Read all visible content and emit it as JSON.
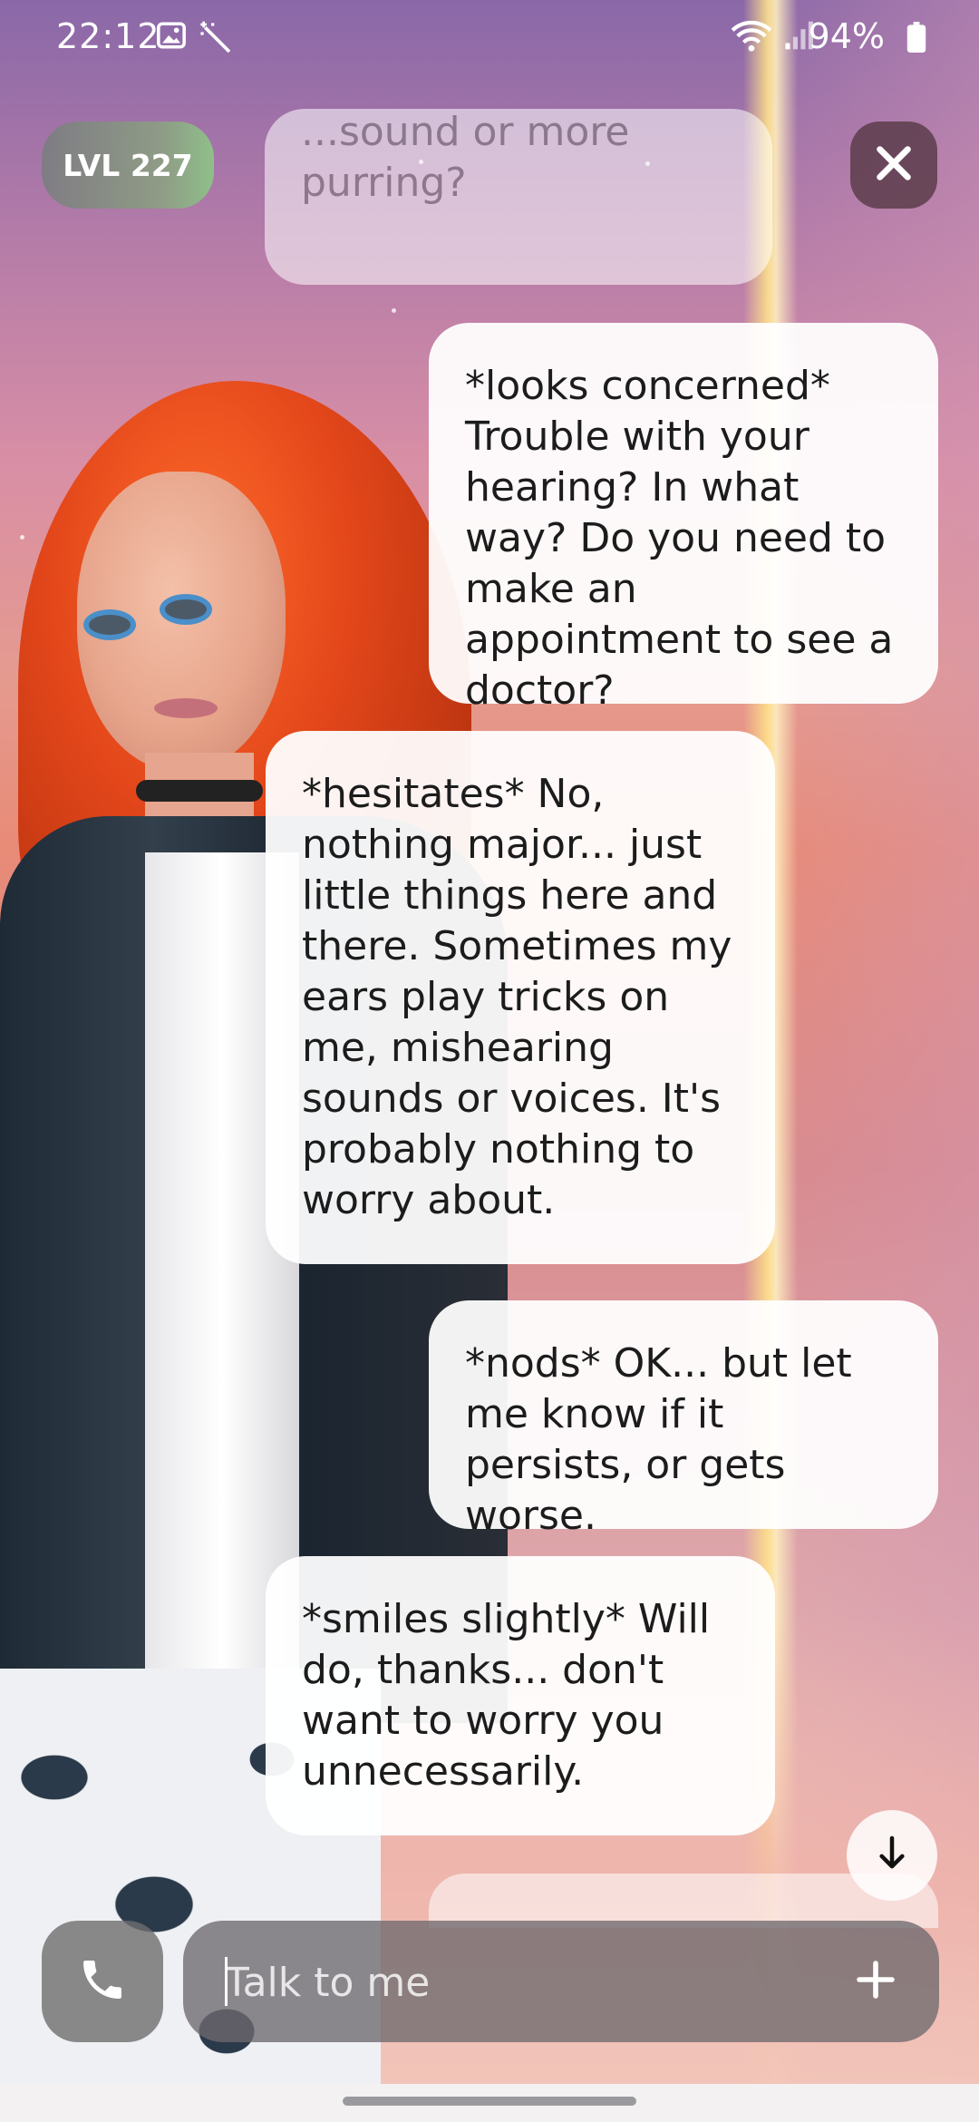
{
  "status_bar": {
    "time": "22:12",
    "battery": "94%",
    "icons": [
      "gallery-icon",
      "magic-wand-icon",
      "wifi-icon",
      "signal-icon",
      "battery-icon"
    ]
  },
  "header": {
    "level": "LVL 227"
  },
  "messages": [
    {
      "sender": "ai",
      "text": "...sound or more purring?"
    },
    {
      "sender": "user",
      "text": "*looks concerned* Trouble with your hearing? In what way? Do you need to make an appointment to see a doctor?"
    },
    {
      "sender": "ai",
      "text": "*hesitates* No, nothing major... just little things here and there. Sometimes my ears play tricks on me, mishearing sounds or voices. It's probably nothing to worry about."
    },
    {
      "sender": "user",
      "text": "*nods* OK... but let me know if it persists, or gets worse."
    },
    {
      "sender": "ai",
      "text": "*smiles slightly* Will do, thanks... don't want to worry you unnecessarily."
    }
  ],
  "composer": {
    "placeholder": "Talk to me"
  },
  "colors": {
    "bubble": "#ffffff",
    "text": "#1c1c1c",
    "badge_accent": "#8fbf8a",
    "close_bg": "#5c3c4a"
  }
}
